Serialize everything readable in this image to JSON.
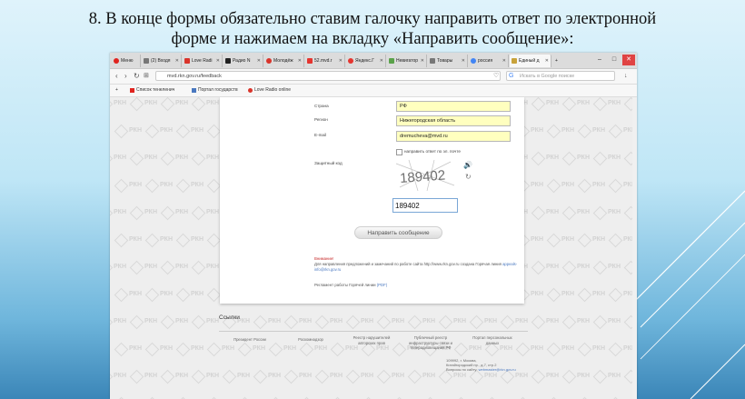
{
  "slide": {
    "title_line1": "8. В конце формы обязательно ставим галочку направить ответ по электронной",
    "title_line2": "форме и нажимаем на вкладку «Направить сообщение»:"
  },
  "browser": {
    "tabs": [
      {
        "label": "Меню",
        "icon_color": "#e0231e"
      },
      {
        "label": "(2) Входя",
        "icon_color": "#777777"
      },
      {
        "label": "Love Radi",
        "icon_color": "#d9342b"
      },
      {
        "label": "Радио N",
        "icon_color": "#222222"
      },
      {
        "label": "Молодёж",
        "icon_color": "#d9342b"
      },
      {
        "label": "52.mvd.r",
        "icon_color": "#e5352f"
      },
      {
        "label": "Яндекс.Г",
        "icon_color": "#e5352f"
      },
      {
        "label": "Невигатор",
        "icon_color": "#5aa24a"
      },
      {
        "label": "Товары",
        "icon_color": "#777777"
      },
      {
        "label": "россия",
        "icon_color": "#4285f4"
      },
      {
        "label": "Единый д",
        "icon_color": "#c8a23a"
      }
    ],
    "url": "mvd.rkn.gov.ru/feedback",
    "search_placeholder": "Искать в Google поиске",
    "bookmarks": [
      {
        "label": "Список тенеленич",
        "icon_color": "#e0231e"
      },
      {
        "label": "Портал государств",
        "icon_color": "#4a78c0"
      },
      {
        "label": "Love Radio online",
        "icon_color": "#d9342b"
      }
    ]
  },
  "form": {
    "country_label": "Страна",
    "country_value": "РФ",
    "region_label": "Регион",
    "region_value": "Нижегородская область",
    "email_label": "E-mail",
    "email_value": "dremucheva@mvd.ru",
    "checkbox_label": "направить ответ по эл. почте",
    "captcha_label": "Защитный код",
    "captcha_code": "189402",
    "captcha_input": "189402",
    "send_button": "Направить сообщение",
    "attention": "Внимание!",
    "note": "Для направления предложений и замечаний по работе сайта http://www.rkn.gov.ru создана Горячая линия",
    "note_email": "appeals-info@rkn.gov.ru",
    "regulation": "Регламент работы Горячей линии",
    "regulation_link": "(PDF)"
  },
  "footer": {
    "links_title": "Ссылки",
    "links": [
      "Президент России",
      "Роскомнадзор",
      "Реестр нарушителей авторских прав",
      "Публичный реестр инфраструктуры связи и телерадиовещания РФ",
      "Портал персональных данных"
    ],
    "address_line1": "109992, г. Москва,",
    "address_line2": "Китайгородский пр., д.7, стр.2",
    "contact_prefix": "Вопросы по сайту:",
    "contact_email": "webmaster@rkn.gov.ru"
  },
  "watermark": "РКН"
}
